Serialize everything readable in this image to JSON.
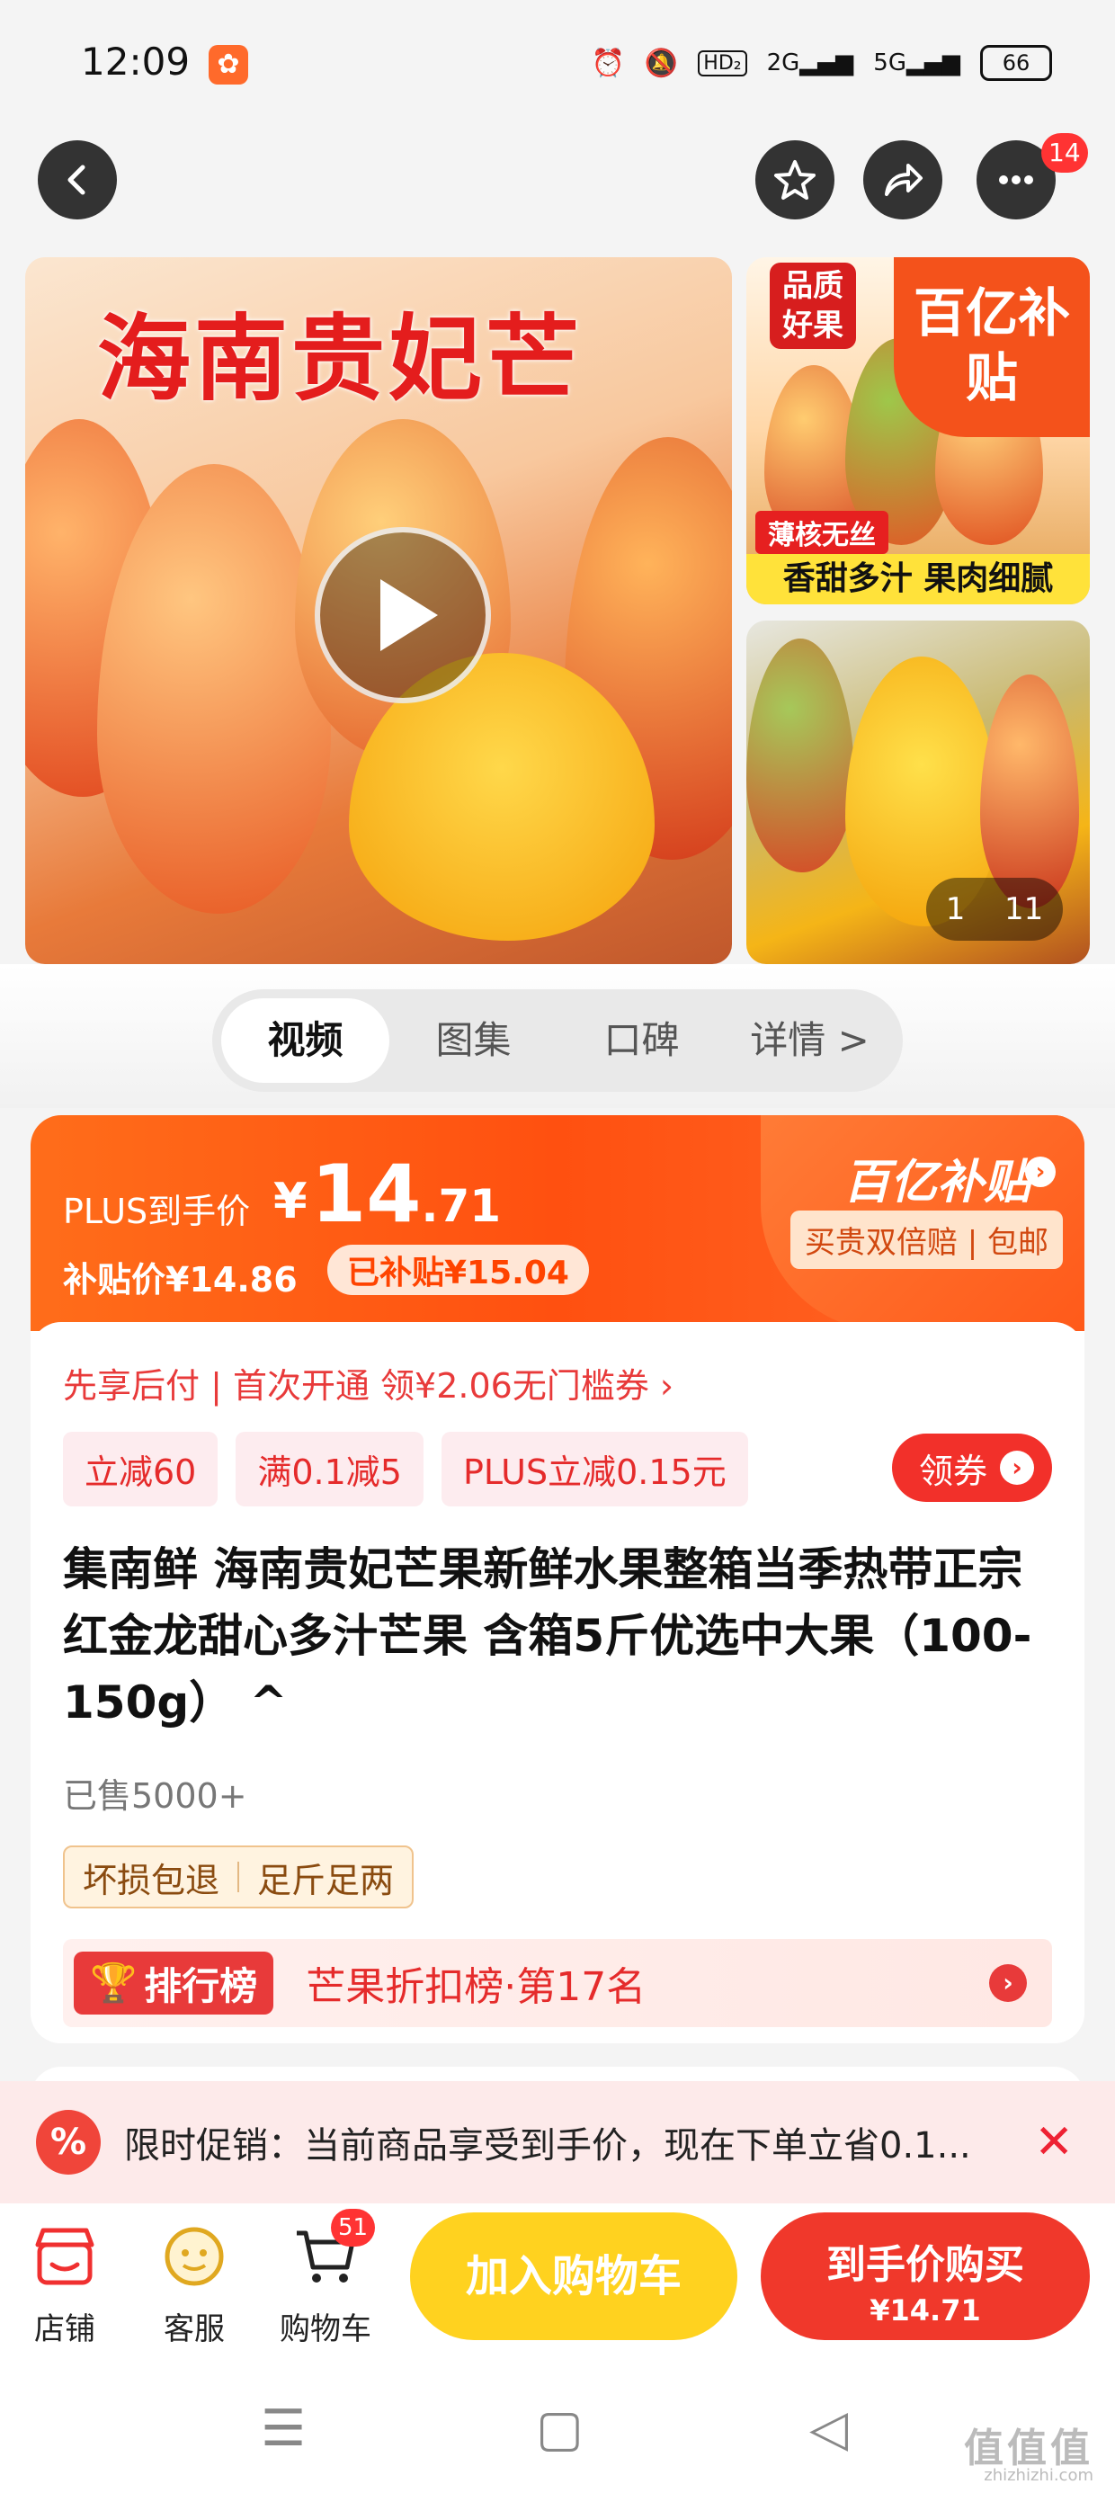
{
  "status_bar": {
    "time": "12:09",
    "battery": "66",
    "network_labels": [
      "HD₂",
      "2G",
      "5G"
    ]
  },
  "header": {
    "more_badge": "14"
  },
  "gallery": {
    "main_overlay_title": "海南贵妃芒",
    "quality_badge": "品质好果",
    "subsidy_badge": "百亿补贴",
    "tag_1": "薄核无丝",
    "tag_2": "香甜多汁 果肉细腻",
    "counter_current": "1",
    "counter_total": "11"
  },
  "media_tabs": [
    {
      "label": "视频",
      "active": true
    },
    {
      "label": "图集",
      "active": false
    },
    {
      "label": "口碑",
      "active": false
    },
    {
      "label": "详情 >",
      "active": false
    }
  ],
  "price": {
    "plus_label": "PLUS到手价",
    "currency": "¥",
    "price_main": "14",
    "price_decimal": ".71",
    "subsidy_price": "补贴价¥14.86",
    "subsidized": "已补贴¥15.04",
    "brand": "百亿补贴",
    "brand_tag": "买贵双倍赔 | 包邮"
  },
  "promo_line": "先享后付 | 首次开通 领¥2.06无门槛券 ›",
  "coupons": [
    "立减60",
    "满0.1减5",
    "PLUS立减0.15元"
  ],
  "get_coupon_label": "领券",
  "product_title": "集南鲜 海南贵妃芒果新鲜水果整箱当季热带正宗红金龙甜心多汁芒果 含箱5斤优选中大果（100-150g） ^",
  "sold": "已售5000+",
  "guarantees": [
    "坏损包退",
    "足斤足两"
  ],
  "ranking": {
    "badge": "排行榜",
    "text": "芒果折扣榜·第17名"
  },
  "limited_promo": {
    "icon_text": "%",
    "text": "限时促销：当前商品享受到手价，现在下单立省0.1..."
  },
  "action_bar": {
    "shop": "店铺",
    "service": "客服",
    "cart": "购物车",
    "cart_badge": "51",
    "add_to_cart": "加入购物车",
    "buy_label": "到手价购买",
    "buy_price": "¥14.71"
  },
  "watermark": {
    "main": "值值值",
    "sub": "zhizhizhi.com"
  },
  "colors": {
    "accent_orange": "#ff5a1a",
    "accent_red": "#f0382b",
    "cart_yellow": "#ffd21f"
  }
}
